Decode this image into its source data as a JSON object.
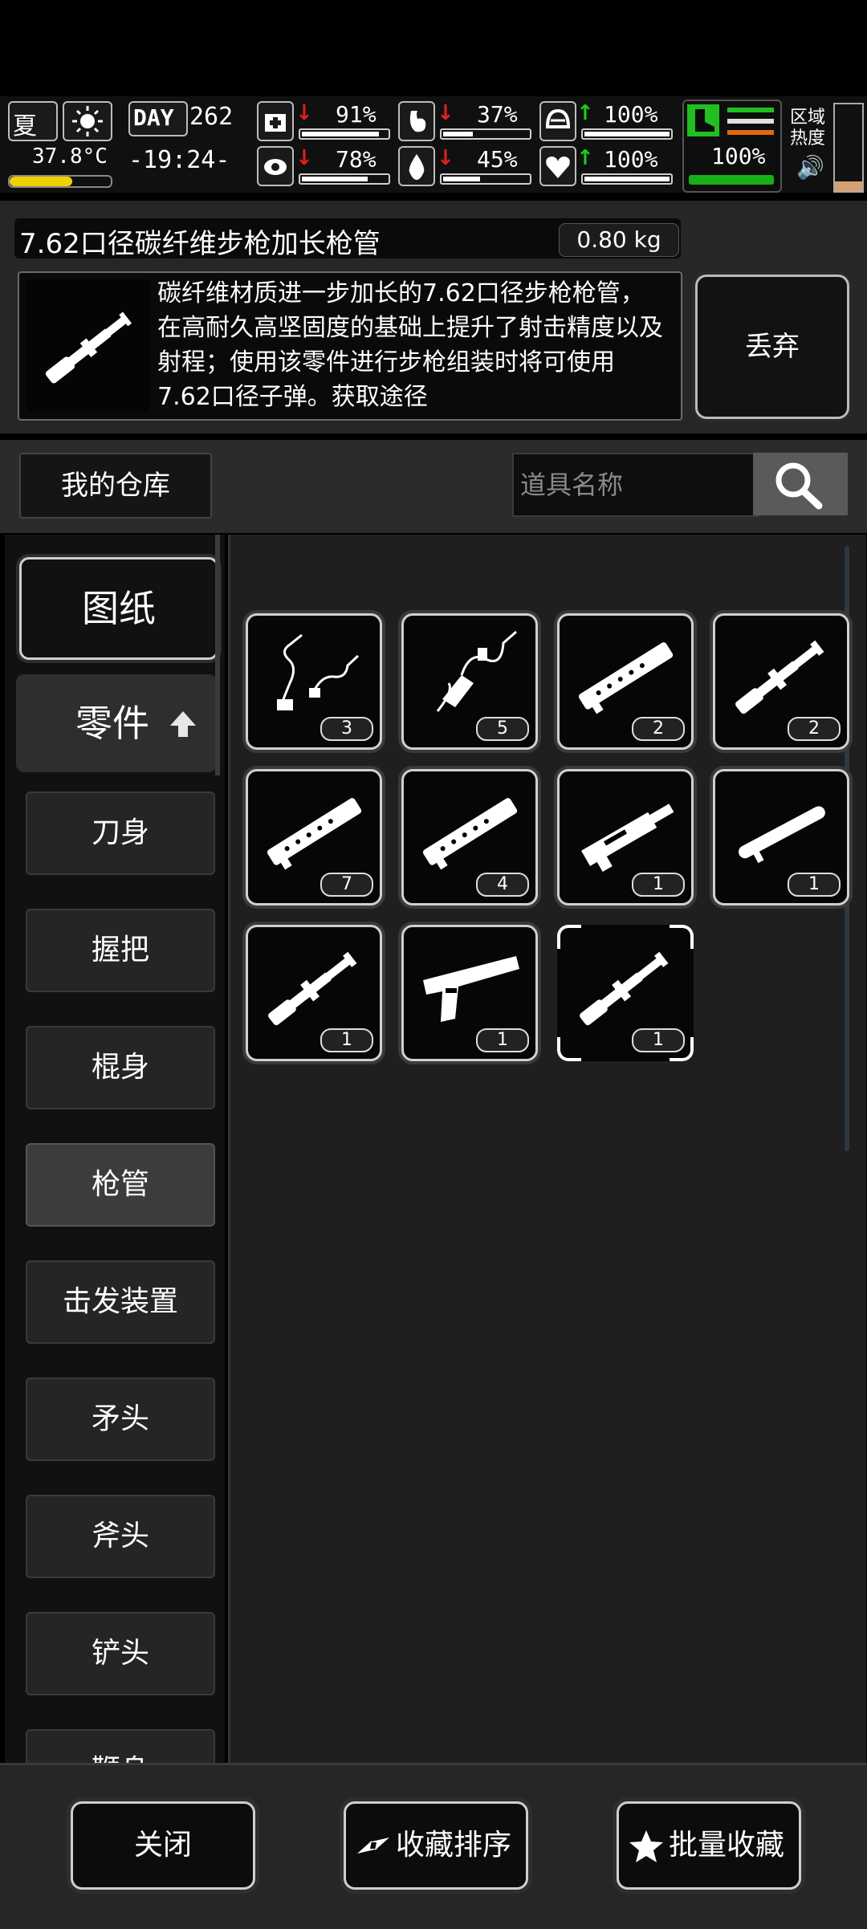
{
  "status": {
    "season": "夏",
    "temperature": "37.8°C",
    "day_label": "DAY",
    "day_number": "262",
    "clock": "-19:24-",
    "health": "91%",
    "hunger": "37%",
    "stamina": "78%",
    "thirst": "45%",
    "armor": "100%",
    "heart": "100%",
    "boot": "100%",
    "zone_heat_label_1": "区域",
    "zone_heat_label_2": "热度",
    "health_level": 0.91,
    "hunger_level": 0.37,
    "stamina_level": 0.78,
    "thirst_level": 0.45,
    "armor_level": 1.0,
    "heart_level": 1.0
  },
  "item": {
    "name": "7.62口径碳纤维步枪加长枪管",
    "weight": "0.80 kg",
    "description": "碳纤维材质进一步加长的7.62口径步枪枪管，在高耐久高坚固度的基础上提升了射击精度以及射程；使用该零件进行步枪组装时将可使用7.62口径子弹。获取途径",
    "discard_label": "丢弃"
  },
  "warehouse": {
    "title": "我的仓库",
    "search_placeholder": "道具名称"
  },
  "categories": {
    "blueprint": "图纸",
    "parts": "零件",
    "items": [
      "刀身",
      "握把",
      "棍身",
      "枪管",
      "击发装置",
      "矛头",
      "斧头",
      "铲头",
      "鞭身"
    ],
    "active": "枪管"
  },
  "grid": {
    "slots": [
      {
        "icon": "wire-icon",
        "count": "3"
      },
      {
        "icon": "wire-gun-icon",
        "count": "5"
      },
      {
        "icon": "rail-barrel-icon",
        "count": "2"
      },
      {
        "icon": "rifle-barrel-icon",
        "count": "2"
      },
      {
        "icon": "rail-barrel-icon",
        "count": "7"
      },
      {
        "icon": "rail-barrel-icon",
        "count": "4"
      },
      {
        "icon": "receiver-icon",
        "count": "1"
      },
      {
        "icon": "short-barrel-icon",
        "count": "1"
      },
      {
        "icon": "rifle-barrel-icon",
        "count": "1"
      },
      {
        "icon": "pistol-frame-icon",
        "count": "1"
      },
      {
        "icon": "rifle-barrel-icon",
        "count": "1"
      }
    ]
  },
  "bottom": {
    "close": "关闭",
    "sort_favorites": "收藏排序",
    "batch_favorite": "批量收藏"
  }
}
